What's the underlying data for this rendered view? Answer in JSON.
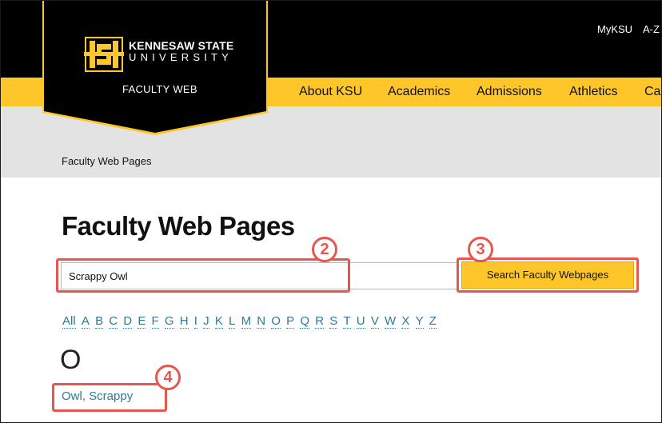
{
  "header": {
    "logo_line1": "KENNESAW STATE",
    "logo_line2": "UNIVERSITY",
    "site_name": "FACULTY WEB",
    "utility_links": [
      "MyKSU",
      "A-Z"
    ],
    "nav": [
      "About KSU",
      "Academics",
      "Admissions",
      "Athletics",
      "Ca"
    ]
  },
  "breadcrumb": "Faculty Web Pages",
  "page_title": "Faculty Web Pages",
  "search": {
    "value": "Scrappy Owl",
    "button_label": "Search Faculty Webpages"
  },
  "annotations": [
    "2",
    "3",
    "4"
  ],
  "alphabet": [
    "All",
    "A",
    "B",
    "C",
    "D",
    "E",
    "F",
    "G",
    "H",
    "I",
    "J",
    "K",
    "L",
    "M",
    "N",
    "O",
    "P",
    "Q",
    "R",
    "S",
    "T",
    "U",
    "V",
    "W",
    "X",
    "Y",
    "Z"
  ],
  "section_letter": "O",
  "results": [
    "Owl, Scrappy"
  ],
  "colors": {
    "gold": "#ffc629",
    "black": "#000000",
    "link": "#2e7a94",
    "annotation": "#e8574f"
  }
}
